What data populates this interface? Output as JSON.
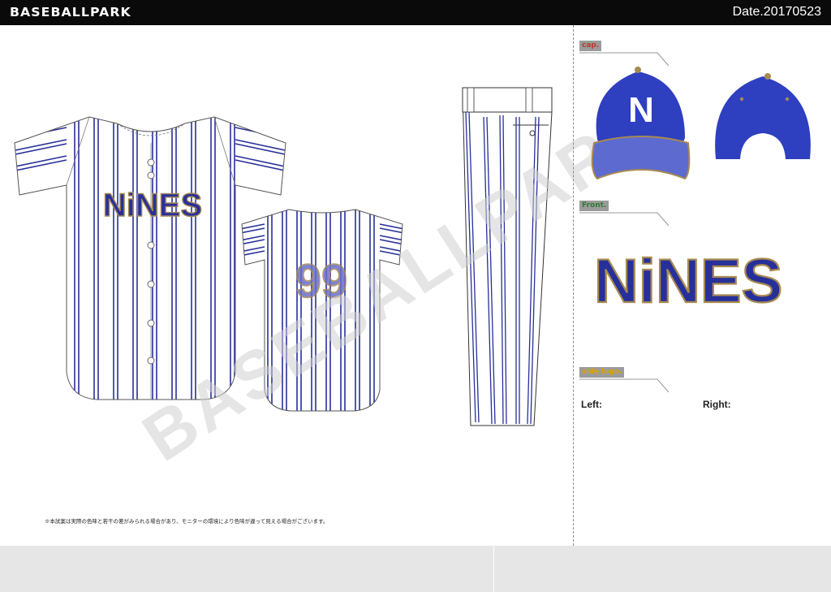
{
  "header": {
    "brand": "BASEBALLPARK",
    "date": "Date.20170523"
  },
  "team": {
    "front_text": "NiNES",
    "back_number": "99",
    "cap_letter": "N"
  },
  "watermark": "BASEBALLPARK",
  "sections": {
    "cap": {
      "label": "cap."
    },
    "front": {
      "label": "Front."
    },
    "side_logo": {
      "label": "side logo.",
      "left_label": "Left:",
      "right_label": "Right:"
    }
  },
  "note": "※本試案は実際の色味と若干の差がみられる場合があり、モニターの環境により色味が違って見える場合がございます。",
  "colors": {
    "navy": "#27309a",
    "gold": "#a88a50",
    "cap_blue": "#2e3fc0",
    "topbar": "#0a0a0a"
  }
}
